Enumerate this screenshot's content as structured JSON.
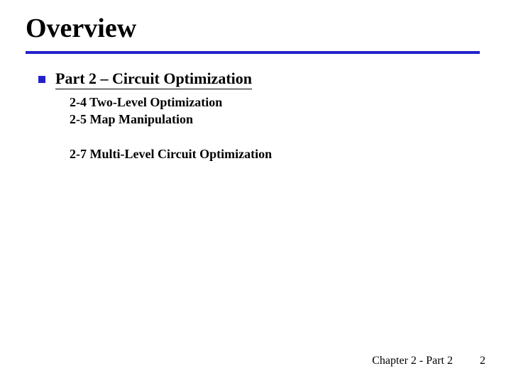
{
  "title": "Overview",
  "bullet": {
    "label": "Part 2 – Circuit Optimization"
  },
  "subitems": {
    "a": "2-4 Two-Level Optimization",
    "b": "2-5 Map Manipulation",
    "c": "2-7 Multi-Level Circuit Optimization"
  },
  "footer": {
    "chapter": "Chapter 2 - Part 2",
    "page": "2"
  }
}
